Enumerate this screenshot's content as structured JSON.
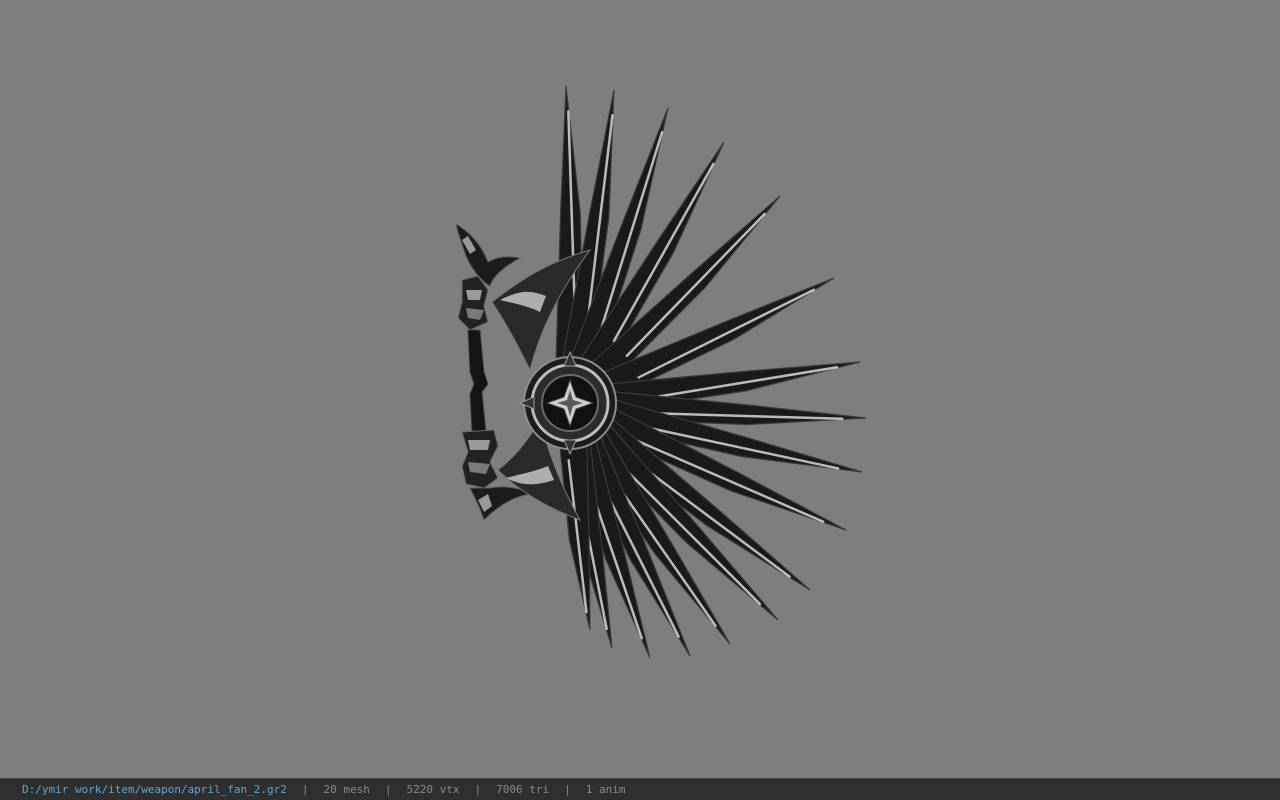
{
  "viewport": {
    "background_color": "#7e7e7e",
    "model": {
      "icon": "war-fan-model",
      "blade_dark": "#1a1a1a",
      "blade_edge": "#d8d8d8",
      "blade_mid": "#3a3a3a"
    }
  },
  "statusbar": {
    "file_path": "D:/ymir work/item/weapon/april_fan_2.gr2",
    "separator": "|",
    "mesh": "20 mesh",
    "vtx": "5220 vtx",
    "tri": "7006 tri",
    "anim": "1 anim",
    "path_color": "#5aa7d8",
    "text_color": "#8a8a8a",
    "background_color": "#2f2f2f"
  }
}
